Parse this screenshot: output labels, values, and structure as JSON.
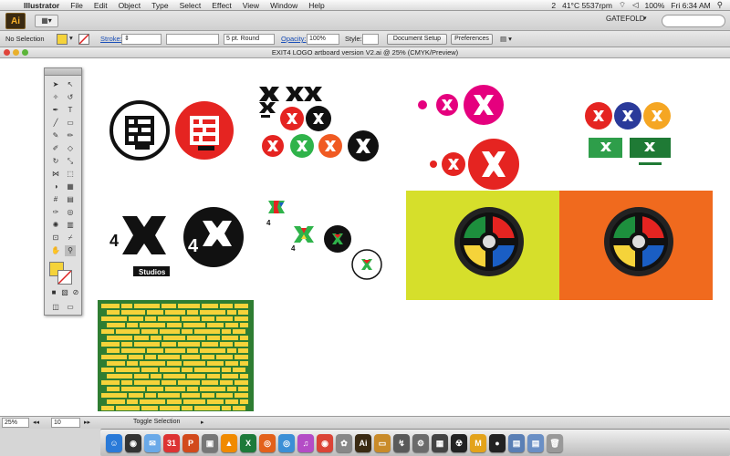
{
  "menubar": {
    "app_name": "Illustrator",
    "items": [
      "File",
      "Edit",
      "Object",
      "Type",
      "Select",
      "Effect",
      "View",
      "Window",
      "Help"
    ],
    "status_icons": [
      "2",
      "41°C 5537rpm",
      "100%",
      "Fri 6:34 AM"
    ]
  },
  "appbar": {
    "logo_text": "Ai",
    "workspace": "GATEFOLD"
  },
  "controlbar": {
    "selection": "No Selection",
    "stroke_label": "Stroke:",
    "brush_value": "5 pt. Round",
    "opacity_label": "Opacity:",
    "opacity_value": "100%",
    "style_label": "Style:",
    "doc_setup": "Document Setup",
    "preferences": "Preferences",
    "fill_color": "#f5d33a"
  },
  "document": {
    "title": "EXIT4 LOGO artboard version V2.ai @ 25% (CMYK/Preview)"
  },
  "artwork": {
    "studios_label": "Studios",
    "four_label": "4",
    "panel_colors": {
      "lime": "#d6df2b",
      "orange": "#f06a1e",
      "green": "#2e7d32",
      "yellow": "#f5d33a"
    }
  },
  "statusbar": {
    "zoom": "25%",
    "artboard": "10",
    "mode": "Toggle Selection"
  },
  "dock": {
    "items": [
      {
        "icon": "finder-icon",
        "glyph": "☺",
        "color": "#2a7ad8"
      },
      {
        "icon": "dashboard-icon",
        "glyph": "◉",
        "color": "#333"
      },
      {
        "icon": "mail-icon",
        "glyph": "✉",
        "color": "#6aa9e8"
      },
      {
        "icon": "calendar-icon",
        "glyph": "31",
        "color": "#d33"
      },
      {
        "icon": "powerpoint-icon",
        "glyph": "P",
        "color": "#d24a1c"
      },
      {
        "icon": "preview-icon",
        "glyph": "▣",
        "color": "#777"
      },
      {
        "icon": "vlc-icon",
        "glyph": "▲",
        "color": "#f08a00"
      },
      {
        "icon": "excel-icon",
        "glyph": "X",
        "color": "#1d7a3a"
      },
      {
        "icon": "firefox-icon",
        "glyph": "◎",
        "color": "#e3611b"
      },
      {
        "icon": "safari-icon",
        "glyph": "◎",
        "color": "#3b8fd6"
      },
      {
        "icon": "itunes-icon",
        "glyph": "♫",
        "color": "#b44cc6"
      },
      {
        "icon": "chrome-icon",
        "glyph": "◉",
        "color": "#db4437"
      },
      {
        "icon": "photos-icon",
        "glyph": "✿",
        "color": "#888"
      },
      {
        "icon": "illustrator-icon",
        "glyph": "Ai",
        "color": "#3a2a12"
      },
      {
        "icon": "folder-icon",
        "glyph": "▭",
        "color": "#c98b2a"
      },
      {
        "icon": "torrent-icon",
        "glyph": "↯",
        "color": "#5a5a5a"
      },
      {
        "icon": "settings-icon",
        "glyph": "⚙",
        "color": "#6b6b6b"
      },
      {
        "icon": "activity-icon",
        "glyph": "▦",
        "color": "#444"
      },
      {
        "icon": "radiation-icon",
        "glyph": "☢",
        "color": "#222"
      },
      {
        "icon": "m-app-icon",
        "glyph": "M",
        "color": "#e3a31b"
      },
      {
        "icon": "app-icon",
        "glyph": "●",
        "color": "#222"
      },
      {
        "icon": "downloads-icon",
        "glyph": "▤",
        "color": "#5a7fb5"
      },
      {
        "icon": "documents-icon",
        "glyph": "▤",
        "color": "#6a8fc5"
      },
      {
        "icon": "trash-icon",
        "glyph": "🗑",
        "color": "#999"
      }
    ]
  }
}
